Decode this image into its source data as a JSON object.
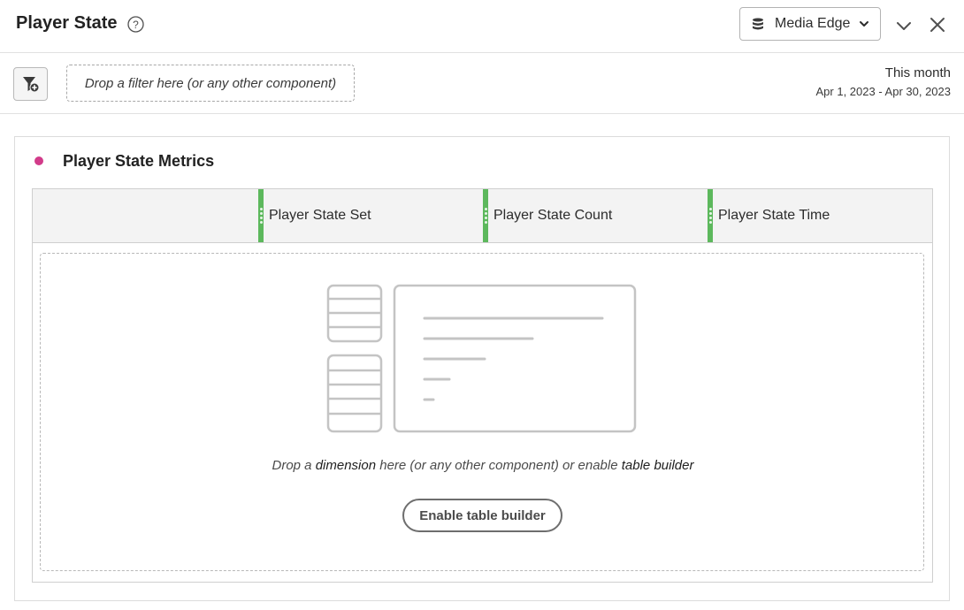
{
  "header": {
    "title": "Player State",
    "data_source": "Media Edge"
  },
  "filter_bar": {
    "drop_placeholder": "Drop a filter here (or any other component)",
    "date_label": "This month",
    "date_range": "Apr 1, 2023 - Apr 30, 2023"
  },
  "visualization": {
    "title": "Player State Metrics",
    "title_dot_color": "#d23b8a",
    "columns": [
      {
        "label": "Player State Set"
      },
      {
        "label": "Player State Count"
      },
      {
        "label": "Player State Time"
      }
    ],
    "column_accent_color": "#5cb85c",
    "drop_text": {
      "prefix": "Drop a ",
      "dimension": "dimension",
      "middle": " here (or any other component) or enable ",
      "builder": "table builder"
    },
    "enable_button": "Enable table builder"
  },
  "icons": {
    "help": "help-circle-icon",
    "data_source": "database-icon",
    "dropdown": "chevron-down-icon",
    "collapse": "chevron-down-icon",
    "close": "close-icon",
    "filter_add": "filter-add-icon",
    "illustration": "table-placeholder-illustration"
  }
}
